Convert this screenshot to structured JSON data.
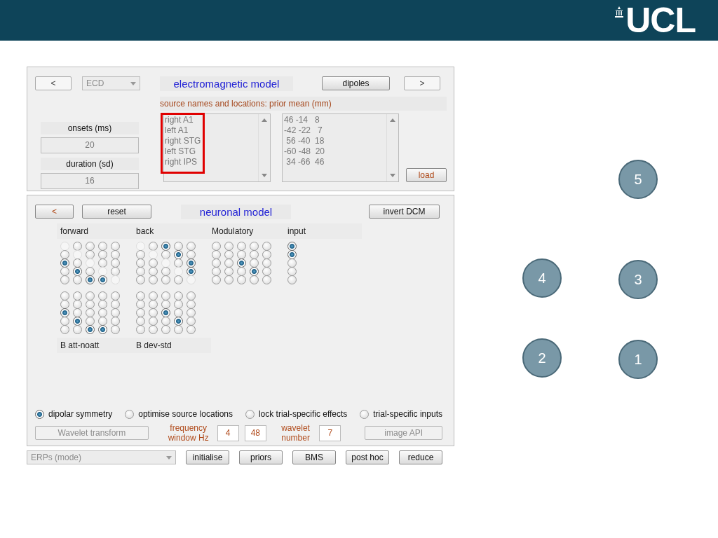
{
  "header": {
    "logo": "UCL"
  },
  "em_panel": {
    "back_button": "<",
    "model_select": "ECD",
    "title": "electromagnetic model",
    "dipoles_button": "dipoles",
    "next_button": ">",
    "sources_label": "source names and locations: prior mean (mm)",
    "onsets_label": "onsets (ms)",
    "onsets_value": "20",
    "duration_label": "duration (sd)",
    "duration_value": "16",
    "names_highlighted": true,
    "source_names": [
      "right A1",
      "left A1",
      "right STG",
      "left STG",
      "right IPS"
    ],
    "source_locations": [
      "46 -14   8",
      "-42 -22   7",
      " 56 -40  18",
      "-60 -48  20",
      " 34 -66  46"
    ],
    "load_button": "load"
  },
  "neuronal_panel": {
    "back_button": "<",
    "reset_button": "reset",
    "title": "neuronal model",
    "invert_button": "invert DCM",
    "top_matrices": [
      {
        "label": "forward",
        "disabled_diagonal": true,
        "cells": [
          [
            false,
            false,
            false,
            false,
            false
          ],
          [
            false,
            false,
            false,
            false,
            false
          ],
          [
            true,
            false,
            false,
            false,
            false
          ],
          [
            false,
            true,
            false,
            false,
            false
          ],
          [
            false,
            false,
            true,
            true,
            false
          ]
        ]
      },
      {
        "label": "back",
        "disabled_diagonal": true,
        "cells": [
          [
            false,
            false,
            true,
            false,
            false
          ],
          [
            false,
            false,
            false,
            true,
            false
          ],
          [
            false,
            false,
            false,
            false,
            true
          ],
          [
            false,
            false,
            false,
            false,
            true
          ],
          [
            false,
            false,
            false,
            false,
            false
          ]
        ]
      },
      {
        "label": "Modulatory",
        "disabled_diagonal": false,
        "cells": [
          [
            false,
            false,
            false,
            false,
            false
          ],
          [
            false,
            false,
            false,
            false,
            false
          ],
          [
            false,
            false,
            true,
            false,
            false
          ],
          [
            false,
            false,
            false,
            true,
            false
          ],
          [
            false,
            false,
            false,
            false,
            false
          ]
        ]
      },
      {
        "label": "input",
        "cells": [
          [
            true
          ],
          [
            true
          ],
          [
            false
          ],
          [
            false
          ],
          [
            false
          ]
        ]
      }
    ],
    "bottom_matrices": [
      {
        "label": "B att-noatt",
        "disabled_diagonal": false,
        "cells": [
          [
            false,
            false,
            false,
            false,
            false
          ],
          [
            false,
            false,
            false,
            false,
            false
          ],
          [
            true,
            false,
            false,
            false,
            false
          ],
          [
            false,
            true,
            false,
            false,
            false
          ],
          [
            false,
            false,
            true,
            true,
            false
          ]
        ]
      },
      {
        "label": "B dev-std",
        "disabled_diagonal": false,
        "cells": [
          [
            false,
            false,
            false,
            false,
            false
          ],
          [
            false,
            false,
            false,
            false,
            false
          ],
          [
            false,
            false,
            true,
            false,
            false
          ],
          [
            false,
            false,
            false,
            true,
            false
          ],
          [
            false,
            false,
            false,
            false,
            false
          ]
        ]
      }
    ],
    "options": [
      {
        "label": "dipolar symmetry",
        "checked": true
      },
      {
        "label": "optimise source locations",
        "checked": false
      },
      {
        "label": "lock trial-specific effects",
        "checked": false
      },
      {
        "label": "trial-specific inputs",
        "checked": false
      }
    ],
    "wavelet_button": {
      "label": "Wavelet transform",
      "disabled": true
    },
    "frequency_label": "frequency window Hz",
    "freq_low": "4",
    "freq_high": "48",
    "wavelet_label": "wavelet number",
    "wavelet_value": "7",
    "image_button": {
      "label": "image API",
      "disabled": true
    }
  },
  "bottom_bar": {
    "mode_select": "ERPs (mode)",
    "buttons": [
      "initialise",
      "priors",
      "BMS",
      "post hoc",
      "reduce"
    ]
  },
  "callouts": [
    {
      "number": "5"
    },
    {
      "number": "4"
    },
    {
      "number": "3"
    },
    {
      "number": "2"
    },
    {
      "number": "1"
    }
  ]
}
